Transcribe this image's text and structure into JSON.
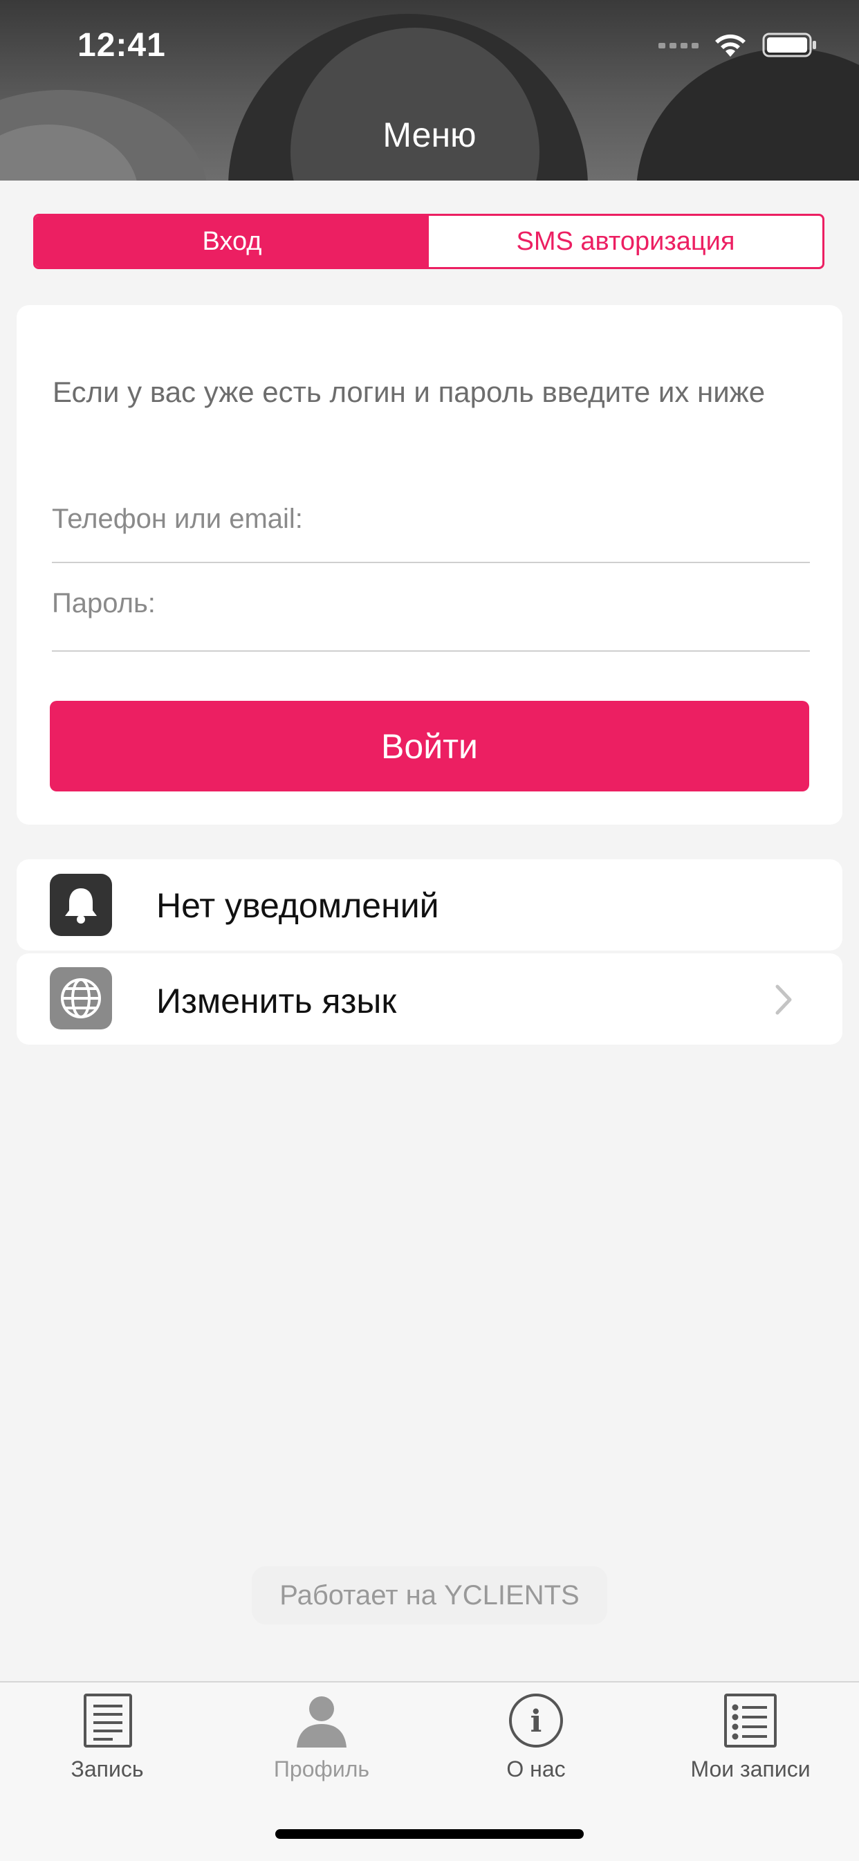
{
  "status_bar": {
    "time": "12:41"
  },
  "header": {
    "title": "Меню"
  },
  "auth_tabs": [
    {
      "label": "Вход",
      "active": true
    },
    {
      "label": "SMS авторизация",
      "active": false
    }
  ],
  "login_form": {
    "intro": "Если у вас уже есть логин и пароль введите их ниже",
    "phone_label": "Телефон или email:",
    "password_label": "Пароль:",
    "submit_label": "Войти"
  },
  "settings": {
    "notifications": {
      "label": "Нет уведомлений",
      "icon": "bell-icon"
    },
    "language": {
      "label": "Изменить язык",
      "icon": "globe-icon"
    }
  },
  "footer": {
    "powered_by": "Работает на YCLIENTS"
  },
  "tab_bar": [
    {
      "label": "Запись",
      "icon": "document-list-icon"
    },
    {
      "label": "Профиль",
      "icon": "person-icon"
    },
    {
      "label": "О нас",
      "icon": "info-icon"
    },
    {
      "label": "Мои записи",
      "icon": "list-icon"
    }
  ],
  "colors": {
    "accent": "#ec1f62",
    "background": "#f4f4f4",
    "tab_active": "#555555",
    "tab_inactive": "#9a9a9a"
  }
}
